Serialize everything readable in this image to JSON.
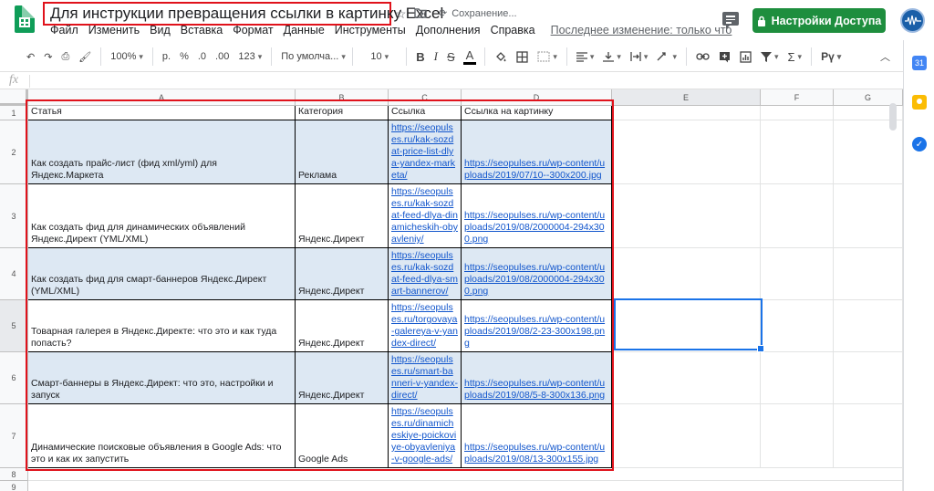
{
  "header": {
    "doc_title": "Для инструкции превращения ссылки в картинку Excel",
    "saving_status": "Сохранение...",
    "share_label": "Настройки Доступа",
    "last_edit": "Последнее изменение: только что"
  },
  "menu": [
    "Файл",
    "Изменить",
    "Вид",
    "Вставка",
    "Формат",
    "Данные",
    "Инструменты",
    "Дополнения",
    "Справка"
  ],
  "toolbar": {
    "zoom": "100%",
    "currency": "р.",
    "percent": "%",
    "dec_less": ".0",
    "dec_more": ".00",
    "more_formats": "123",
    "font": "По умолча...",
    "font_size": "10",
    "bold": "B",
    "italic": "I",
    "strike": "S",
    "text_color": "A",
    "sum": "Σ",
    "lang": "Рү"
  },
  "formula_bar": {
    "fx": "fx"
  },
  "columns": [
    "A",
    "B",
    "C",
    "D",
    "E",
    "F",
    "G"
  ],
  "rows": [
    "1",
    "2",
    "3",
    "4",
    "5",
    "6",
    "7",
    "8",
    "9"
  ],
  "table": {
    "headers": [
      "Статья",
      "Категория",
      "Ссылка",
      "Ссылка на картинку"
    ],
    "rows": [
      {
        "article": "Как создать прайс-лист (фид xml/yml) для Яндекс.Маркета",
        "category": "Реклама",
        "link": "https://seopulses.ru/kak-sozdat-price-list-dlya-yandex-marketa/",
        "image_link": "https://seopulses.ru/wp-content/uploads/2019/07/10--300x200.jpg"
      },
      {
        "article": "Как создать фид для динамических объявлений Яндекс.Директ (YML/XML)",
        "category": "Яндекс.Директ",
        "link": "https://seopulses.ru/kak-sozdat-feed-dlya-dinamicheskih-obyavleniy/",
        "image_link": "https://seopulses.ru/wp-content/uploads/2019/08/2000004-294x300.png"
      },
      {
        "article": "Как создать фид для смарт-баннеров Яндекс.Директ (YML/XML)",
        "category": "Яндекс.Директ",
        "link": "https://seopulses.ru/kak-sozdat-feed-dlya-smart-bannerov/",
        "image_link": "https://seopulses.ru/wp-content/uploads/2019/08/2000004-294x300.png"
      },
      {
        "article": "Товарная галерея в Яндекс.Директе: что это и как туда попасть?",
        "category": "Яндекс.Директ",
        "link": "https://seopulses.ru/torgovaya-galereya-v-yandex-direct/",
        "image_link": "https://seopulses.ru/wp-content/uploads/2019/08/2-23-300x198.png"
      },
      {
        "article": "Смарт-баннеры в Яндекс.Директ: что это, настройки и запуск",
        "category": "Яндекс.Директ",
        "link": "https://seopulses.ru/smart-banneri-v-yandex-direct/",
        "image_link": "https://seopulses.ru/wp-content/uploads/2019/08/5-8-300x136.png"
      },
      {
        "article": "Динамические поисковые объявления в Google Ads: что это и как их запустить",
        "category": "Google Ads",
        "link": "https://seopulses.ru/dinamicheskiye-poickoviye-obyavleniya-v-google-ads/",
        "image_link": "https://seopulses.ru/wp-content/uploads/2019/08/13-300x155.jpg"
      }
    ]
  },
  "colors": {
    "accent_red": "#e0121b",
    "share_green": "#1e8e3e",
    "selection_blue": "#1a73e8",
    "shaded_row": "#dde8f3",
    "link": "#1155cc"
  }
}
